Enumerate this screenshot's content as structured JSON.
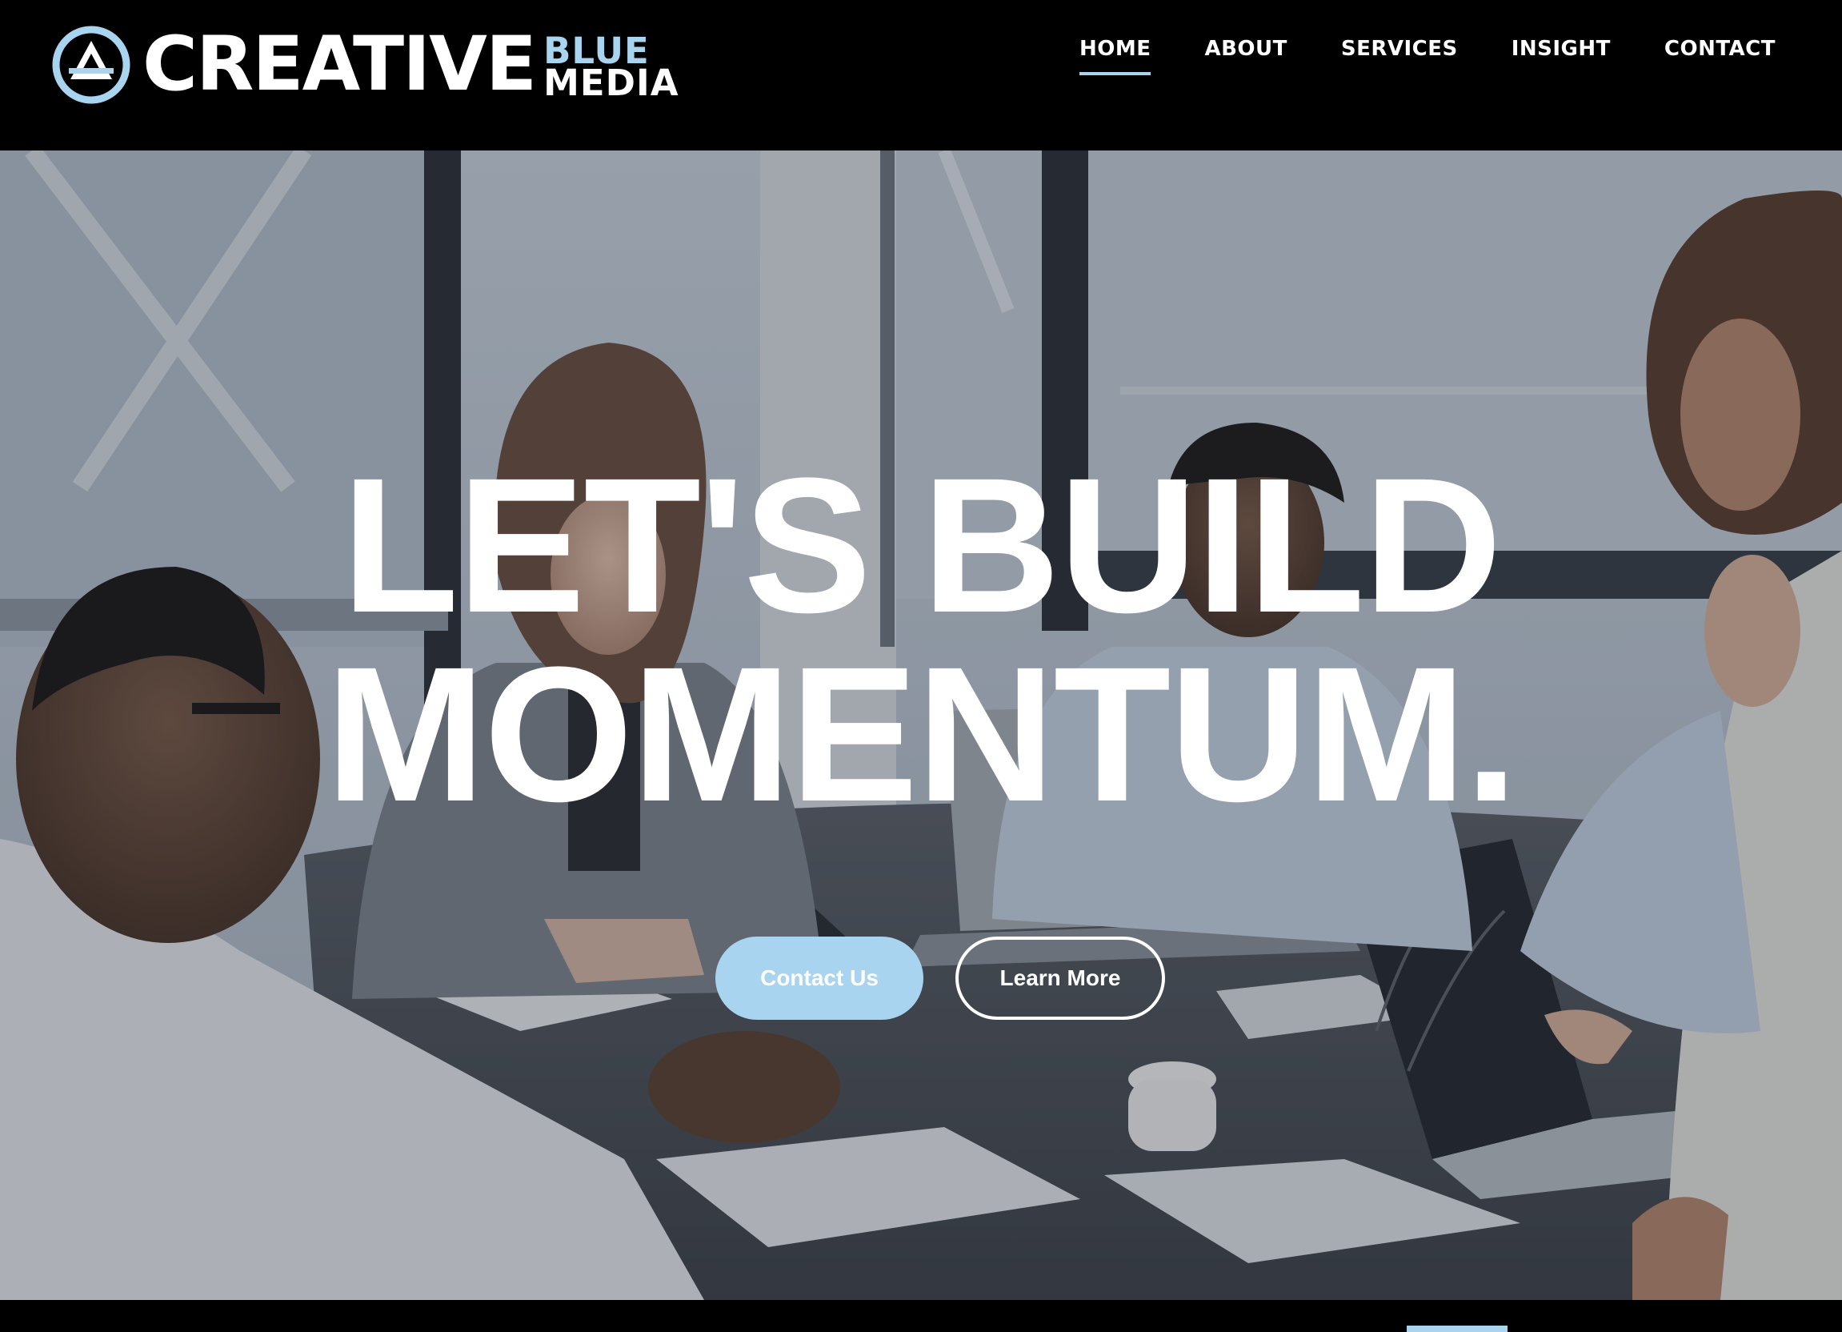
{
  "header": {
    "logo": {
      "word": "CREATIVE",
      "blue": "BLUE",
      "media": "MEDIA",
      "icon": "triangle-circle-logo-icon"
    },
    "nav": [
      {
        "label": "HOME",
        "active": true
      },
      {
        "label": "ABOUT",
        "active": false
      },
      {
        "label": "SERVICES",
        "active": false
      },
      {
        "label": "INSIGHT",
        "active": false
      },
      {
        "label": "CONTACT",
        "active": false
      }
    ]
  },
  "hero": {
    "headline_line1": "LET'S BUILD",
    "headline_line2": "MOMENTUM.",
    "primary_cta": "Contact Us",
    "secondary_cta": "Learn More"
  },
  "colors": {
    "accent": "#a8d4f0",
    "background": "#000000",
    "text": "#ffffff"
  }
}
